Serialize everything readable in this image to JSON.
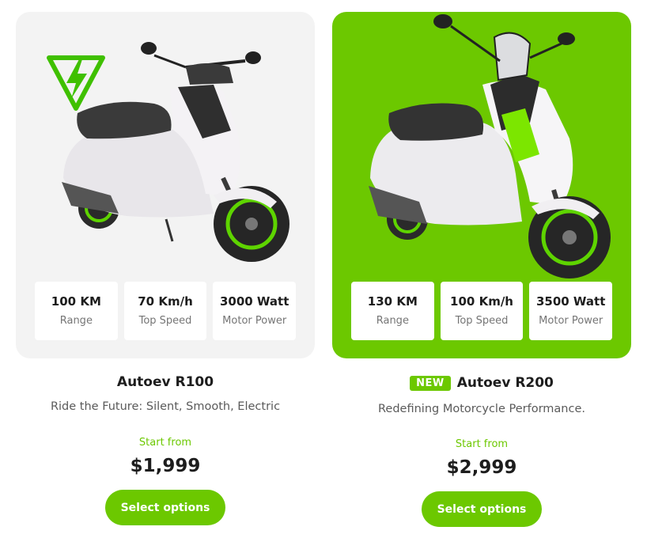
{
  "colors": {
    "accent": "#6cc800",
    "card_bg_light": "#f3f3f3",
    "text_dark": "#1d1d1d",
    "text_muted": "#757575"
  },
  "products": [
    {
      "name": "Autoev R100",
      "tagline": "Ride the Future: Silent, Smooth, Electric",
      "start_from_label": "Start from",
      "price": "$1,999",
      "button_label": "Select options",
      "icon": "lightning-triangle-icon",
      "specs": [
        {
          "value": "100 KM",
          "label": "Range"
        },
        {
          "value": "70 Km/h",
          "label": "Top Speed"
        },
        {
          "value": "3000 Watt",
          "label": "Motor Power"
        }
      ]
    },
    {
      "badge": "NEW",
      "name": "Autoev R200",
      "tagline": "Redefining Motorcycle Performance.",
      "start_from_label": "Start from",
      "price": "$2,999",
      "button_label": "Select options",
      "specs": [
        {
          "value": "130 KM",
          "label": "Range"
        },
        {
          "value": "100 Km/h",
          "label": "Top Speed"
        },
        {
          "value": "3500 Watt",
          "label": "Motor Power"
        }
      ]
    }
  ]
}
